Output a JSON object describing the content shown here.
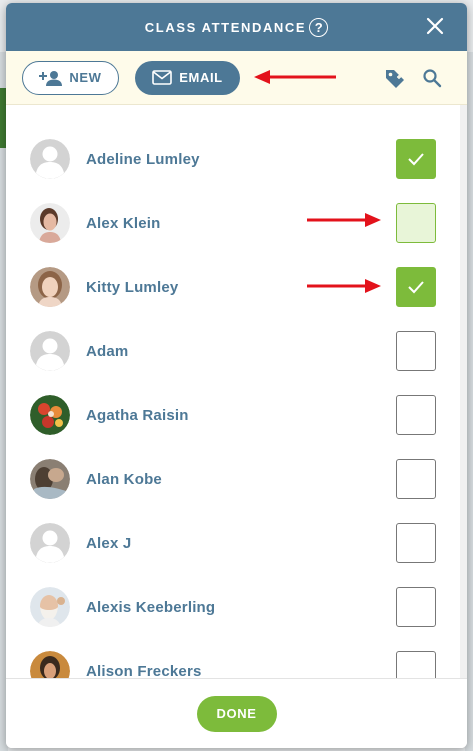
{
  "modal": {
    "title": "CLASS ATTENDANCE",
    "help_glyph": "?"
  },
  "toolbar": {
    "new_label": "NEW",
    "email_label": "EMAIL",
    "icons": [
      "person-add-icon",
      "mail-icon",
      "tag-icon",
      "search-icon"
    ]
  },
  "students": [
    {
      "name": "Adeline Lumley",
      "avatar": "placeholder",
      "checked": true
    },
    {
      "name": "Alex Klein",
      "avatar": "photo",
      "checked": false,
      "pending": true
    },
    {
      "name": "Kitty Lumley",
      "avatar": "photo",
      "checked": true
    },
    {
      "name": "Adam",
      "avatar": "placeholder",
      "checked": false
    },
    {
      "name": "Agatha Raisin",
      "avatar": "photo",
      "checked": false
    },
    {
      "name": "Alan Kobe",
      "avatar": "photo",
      "checked": false
    },
    {
      "name": "Alex J",
      "avatar": "placeholder",
      "checked": false
    },
    {
      "name": "Alexis Keeberling",
      "avatar": "photo",
      "checked": false
    },
    {
      "name": "Alison Freckers",
      "avatar": "photo",
      "checked": false
    }
  ],
  "footer": {
    "done_label": "DONE"
  },
  "colors": {
    "header": "#4d7896",
    "toolbar_bg": "#fefbea",
    "accent_green": "#7dbb3b",
    "annotation_red": "#e3121b"
  }
}
